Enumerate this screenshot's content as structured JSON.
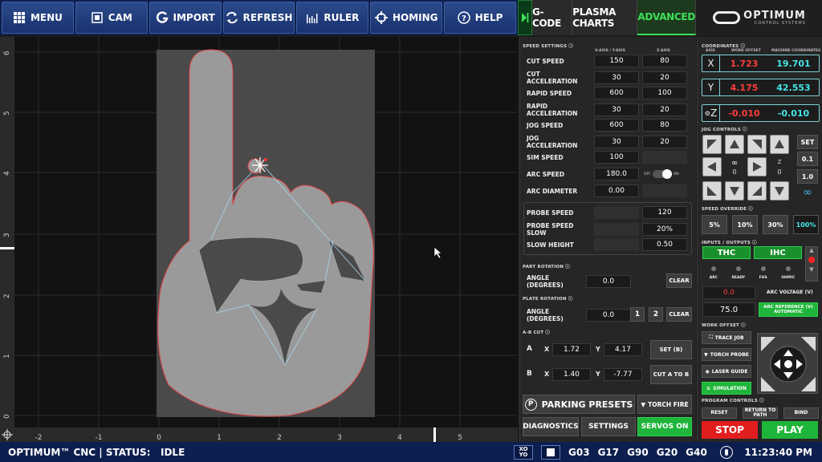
{
  "toolbar": {
    "items": [
      {
        "label": "MENU",
        "icon": "grid-icon"
      },
      {
        "label": "CAM",
        "icon": "cam-icon"
      },
      {
        "label": "IMPORT",
        "icon": "import-icon"
      },
      {
        "label": "REFRESH",
        "icon": "refresh-icon"
      },
      {
        "label": "RULER",
        "icon": "ruler-icon"
      },
      {
        "label": "HOMING",
        "icon": "crosshair-icon"
      },
      {
        "label": "HELP",
        "icon": "help-icon"
      }
    ]
  },
  "tabs": [
    "G-CODE",
    "PLASMA CHARTS",
    "ADVANCED"
  ],
  "logo": {
    "name": "OPTIMUM",
    "sub": "CONTROL SYSTEMS"
  },
  "canvas": {
    "x_ticks": [
      "-2",
      "-1",
      "0",
      "1",
      "2",
      "3",
      "4",
      "5"
    ],
    "y_ticks": [
      "6",
      "5",
      "4",
      "3",
      "2",
      "1",
      "0"
    ]
  },
  "speed_settings": {
    "title": "SPEED SETTINGS",
    "col1": "X-AXIS / Y-AXIS",
    "col2": "Z-AXIS",
    "rows": [
      {
        "label": "CUT SPEED",
        "xy": "150",
        "z": "80"
      },
      {
        "label": "CUT ACCELERATION",
        "xy": "30",
        "z": "20"
      },
      {
        "label": "RAPID SPEED",
        "xy": "600",
        "z": "100"
      },
      {
        "label": "RAPID ACCELERATION",
        "xy": "30",
        "z": "20"
      },
      {
        "label": "JOG SPEED",
        "xy": "600",
        "z": "80"
      },
      {
        "label": "JOG ACCELERATION",
        "xy": "30",
        "z": "20"
      },
      {
        "label": "SIM SPEED",
        "xy": "100",
        "z": ""
      },
      {
        "label": "ARC SPEED",
        "xy": "180.0",
        "z": ""
      },
      {
        "label": "ARC DIAMETER",
        "xy": "0.00",
        "z": ""
      }
    ],
    "toggle_off": "OFF",
    "toggle_on": "ON"
  },
  "probe": {
    "rows": [
      {
        "label": "PROBE SPEED",
        "value": "120"
      },
      {
        "label": "PROBE SPEED SLOW",
        "value": "20%"
      },
      {
        "label": "SLOW HEIGHT",
        "value": "0.50"
      }
    ]
  },
  "part_rotation": {
    "title": "PART ROTATION",
    "label": "ANGLE (DEGREES)",
    "value": "0.0",
    "clear": "CLEAR"
  },
  "plate_rotation": {
    "title": "PLATE ROTATION",
    "label": "ANGLE (DEGREES)",
    "value": "0.0",
    "btn1": "1",
    "btn2": "2",
    "clear": "CLEAR"
  },
  "ab_cut": {
    "title": "A-B CUT",
    "a_label": "A",
    "b_label": "B",
    "ax": "1.72",
    "ay": "4.17",
    "bx": "1.40",
    "by": "-7.77",
    "x": "X",
    "y": "Y",
    "set_b": "SET (B)",
    "cut_a_to_b": "CUT A TO B"
  },
  "bottom_buttons": {
    "parking": "PARKING PRESETS",
    "torch_fire": "TORCH FIRE",
    "diagnostics": "DIAGNOSTICS",
    "settings": "SETTINGS",
    "servos_on": "SERVOS ON"
  },
  "coordinates": {
    "title": "COORDINATES",
    "h_axis": "AXIS",
    "h_work": "WORK OFFSET",
    "h_machine": "MACHINE COORDINATES",
    "rows": [
      {
        "axis": "X",
        "work": "1.723",
        "machine": "19.701"
      },
      {
        "axis": "Y",
        "work": "4.175",
        "machine": "42.553"
      },
      {
        "axis": "Z",
        "work": "-0.010",
        "machine": "-0.010"
      }
    ]
  },
  "jog": {
    "title": "JOG CONTROLS",
    "set": "SET",
    "step1": "0.1",
    "step2": "1.0",
    "inf": "∞",
    "xy_inf": "∞",
    "xy_val": "0",
    "z_lbl": "Z",
    "z_val": "0"
  },
  "speed_override": {
    "title": "SPEED OVERRIDE",
    "options": [
      "5%",
      "10%",
      "30%",
      "100%"
    ]
  },
  "io": {
    "title": "INPUTS / OUTPUTS",
    "thc": "THC",
    "ihc": "IHC",
    "leds": [
      "ARC",
      "READY",
      "FHS",
      "OHMIC"
    ],
    "arc_voltage_value": "0.0",
    "arc_voltage_label": "ARC VOLTAGE (V)",
    "arc_ref_value": "75.0",
    "arc_ref_label": "ARC REFERENCE (V) AUTOMATIC"
  },
  "work_offset": {
    "title": "WORK OFFSET",
    "buttons": [
      "TRACE JOB",
      "TORCH PROBE",
      "LASER GUIDE",
      "SIMULATION"
    ]
  },
  "program_controls": {
    "title": "PROGRAM CONTROLS",
    "reset": "RESET",
    "return": "RETURN TO PATH",
    "bind": "BIND",
    "stop": "STOP",
    "play": "PLAY"
  },
  "status": {
    "left": "OPTIMUM™ CNC | STATUS:   IDLE",
    "xo": "XO YO",
    "gcodes": [
      "G03",
      "G17",
      "G90",
      "G20",
      "G40"
    ],
    "time": "11:23:40 PM"
  },
  "colors": {
    "accent": "#3ee05a",
    "work": "#ff3b3b",
    "machine": "#44e6e6",
    "toolbar": "#0d1f4e"
  }
}
